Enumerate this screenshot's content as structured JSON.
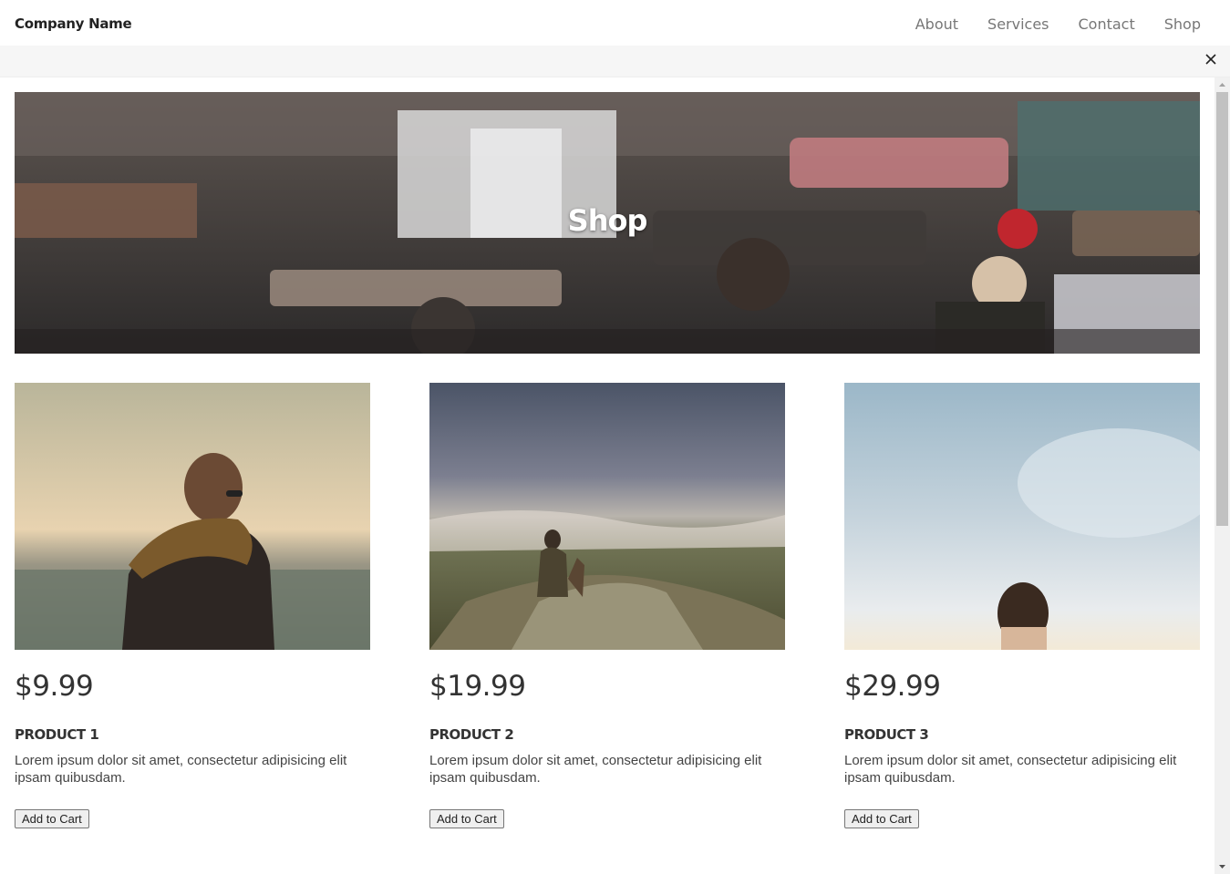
{
  "navbar": {
    "brand": "Company Name",
    "links": [
      "About",
      "Services",
      "Contact",
      "Shop"
    ]
  },
  "banner": {
    "close_icon": "close-icon"
  },
  "hero": {
    "title": "Shop"
  },
  "products": [
    {
      "price": "$9.99",
      "name": "PRODUCT 1",
      "description": "Lorem ipsum dolor sit amet, consectetur adipisicing elit ipsam quibusdam.",
      "button": "Add to Cart"
    },
    {
      "price": "$19.99",
      "name": "PRODUCT 2",
      "description": "Lorem ipsum dolor sit amet, consectetur adipisicing elit ipsam quibusdam.",
      "button": "Add to Cart"
    },
    {
      "price": "$29.99",
      "name": "PRODUCT 3",
      "description": "Lorem ipsum dolor sit amet, consectetur adipisicing elit ipsam quibusdam.",
      "button": "Add to Cart"
    }
  ]
}
